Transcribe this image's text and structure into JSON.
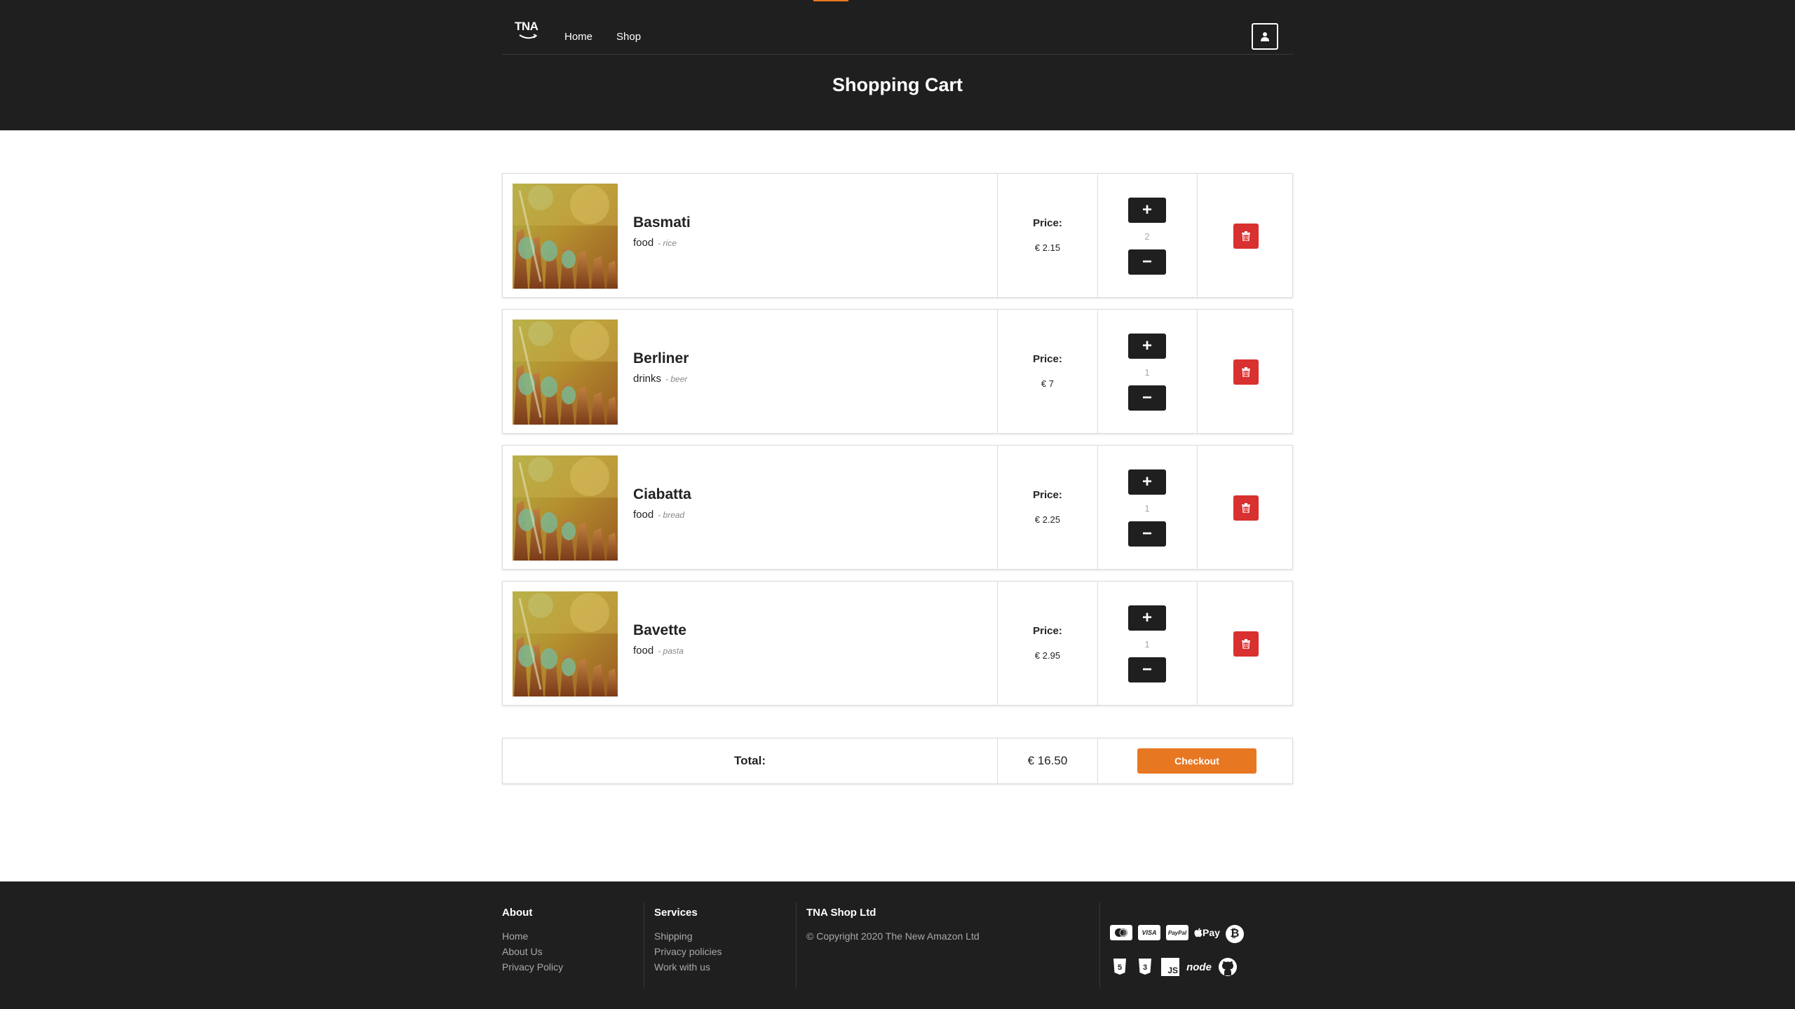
{
  "header": {
    "logo_text": "TNA",
    "nav": [
      {
        "label": "Home"
      },
      {
        "label": "Shop"
      }
    ],
    "page_title": "Shopping Cart"
  },
  "cart": {
    "price_label": "Price:",
    "items": [
      {
        "name": "Basmati",
        "category": "food",
        "subcategory": "- rice",
        "price": "€ 2.15",
        "quantity": "2"
      },
      {
        "name": "Berliner",
        "category": "drinks",
        "subcategory": "- beer",
        "price": "€ 7",
        "quantity": "1"
      },
      {
        "name": "Ciabatta",
        "category": "food",
        "subcategory": "- bread",
        "price": "€ 2.25",
        "quantity": "1"
      },
      {
        "name": "Bavette",
        "category": "food",
        "subcategory": "- pasta",
        "price": "€ 2.95",
        "quantity": "1"
      }
    ],
    "total_label": "Total:",
    "total_value": "€ 16.50",
    "checkout_label": "Checkout"
  },
  "footer": {
    "about": {
      "title": "About",
      "links": [
        "Home",
        "About Us",
        "Privacy Policy"
      ]
    },
    "services": {
      "title": "Services",
      "links": [
        "Shipping",
        "Privacy policies",
        "Work with us"
      ]
    },
    "company": {
      "title": "TNA Shop Ltd",
      "copyright": "© Copyright 2020 The New Amazon Ltd"
    },
    "payment_icons": [
      {
        "name": "mastercard-icon",
        "label": ""
      },
      {
        "name": "visa-icon",
        "label": "VISA"
      },
      {
        "name": "paypal-icon",
        "label": "PayPal"
      },
      {
        "name": "apple-pay-icon",
        "label": "Pay"
      },
      {
        "name": "bitcoin-icon",
        "label": "₿"
      }
    ],
    "tech_icons": [
      {
        "name": "html5-icon",
        "label": "5"
      },
      {
        "name": "css3-icon",
        "label": "3"
      },
      {
        "name": "js-icon",
        "label": "JS"
      },
      {
        "name": "node-icon",
        "label": "node"
      },
      {
        "name": "github-icon",
        "label": ""
      }
    ]
  },
  "colors": {
    "header_bg": "#1f1f1f",
    "accent": "#e87722",
    "delete": "#d93030"
  }
}
